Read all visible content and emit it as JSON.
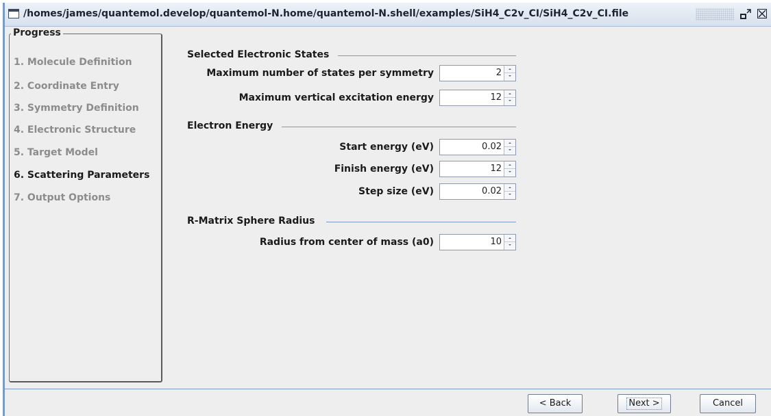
{
  "window": {
    "title": "/homes/james/quantemol.develop/quantemol-N.home/quantemol-N.shell/examples/SiH4_C2v_CI/SiH4_C2v_CI.file",
    "restore_glyph": "⌞⌝"
  },
  "progress": {
    "title": "Progress",
    "steps": [
      {
        "label": "1. Molecule Definition",
        "active": false
      },
      {
        "label": "2. Coordinate Entry",
        "active": false
      },
      {
        "label": "3. Symmetry Definition",
        "active": false
      },
      {
        "label": "4. Electronic Structure",
        "active": false
      },
      {
        "label": "5. Target Model",
        "active": false
      },
      {
        "label": "6. Scattering Parameters",
        "active": true
      },
      {
        "label": "7. Output Options",
        "active": false
      }
    ]
  },
  "sections": {
    "electronic_states": {
      "title": "Selected Electronic States",
      "fields": [
        {
          "label": "Maximum number of states per symmetry",
          "value": "2"
        },
        {
          "label": "Maximum vertical excitation energy",
          "value": "12"
        }
      ]
    },
    "electron_energy": {
      "title": "Electron Energy",
      "fields": [
        {
          "label": "Start energy (eV)",
          "value": "0.02"
        },
        {
          "label": "Finish energy (eV)",
          "value": "12"
        },
        {
          "label": "Step size (eV)",
          "value": "0.02"
        }
      ]
    },
    "rmatrix": {
      "title": "R-Matrix Sphere Radius",
      "fields": [
        {
          "label": "Radius from center of mass (a0)",
          "value": "10"
        }
      ]
    }
  },
  "buttons": {
    "back": "< Back",
    "next": "Next >",
    "cancel": "Cancel"
  },
  "colors": {
    "accent_line": "#7a9cc4",
    "inactive_step": "#8c8c8c",
    "active_step": "#1a1a1a"
  },
  "icons": {
    "window": "window-icon",
    "restore": "restore-icon",
    "close": "close-icon",
    "spinner_up": "spinner-up-icon",
    "spinner_down": "spinner-down-icon"
  }
}
